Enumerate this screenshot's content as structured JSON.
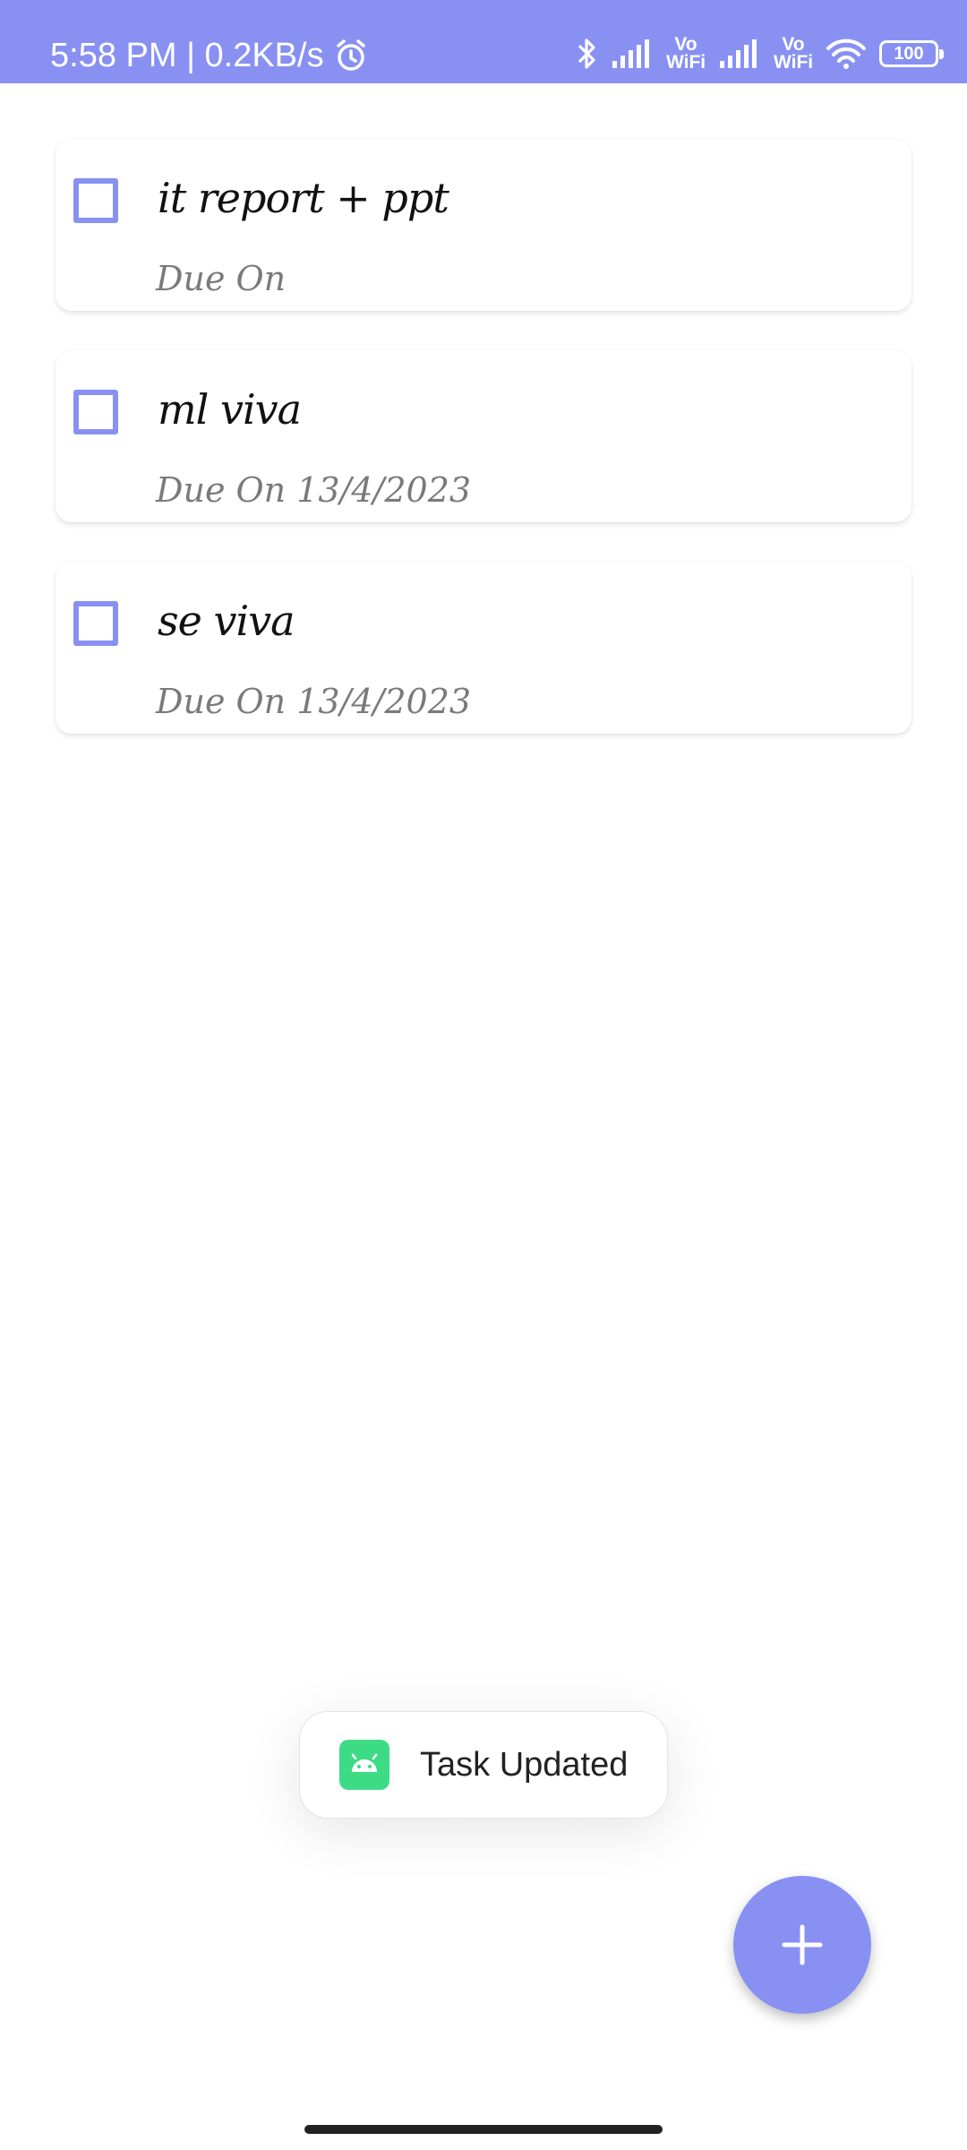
{
  "status_bar": {
    "time_speed": "5:58 PM | 0.2KB/s",
    "vowifi_1": "Vo\nWiFi",
    "vowifi_2": "Vo\nWiFi",
    "battery": "100",
    "background_color": "#8891f2"
  },
  "tasks": [
    {
      "title": "it report + ppt",
      "due": "Due On",
      "checked": false
    },
    {
      "title": "ml viva",
      "due": "Due On 13/4/2023",
      "checked": false
    },
    {
      "title": "se viva",
      "due": "Due On 13/4/2023",
      "checked": false
    }
  ],
  "toast": {
    "text": "Task Updated",
    "icon": "android-app-icon"
  },
  "fab": {
    "icon": "plus-icon",
    "color": "#8891f2"
  },
  "accent_color": "#8891f2"
}
